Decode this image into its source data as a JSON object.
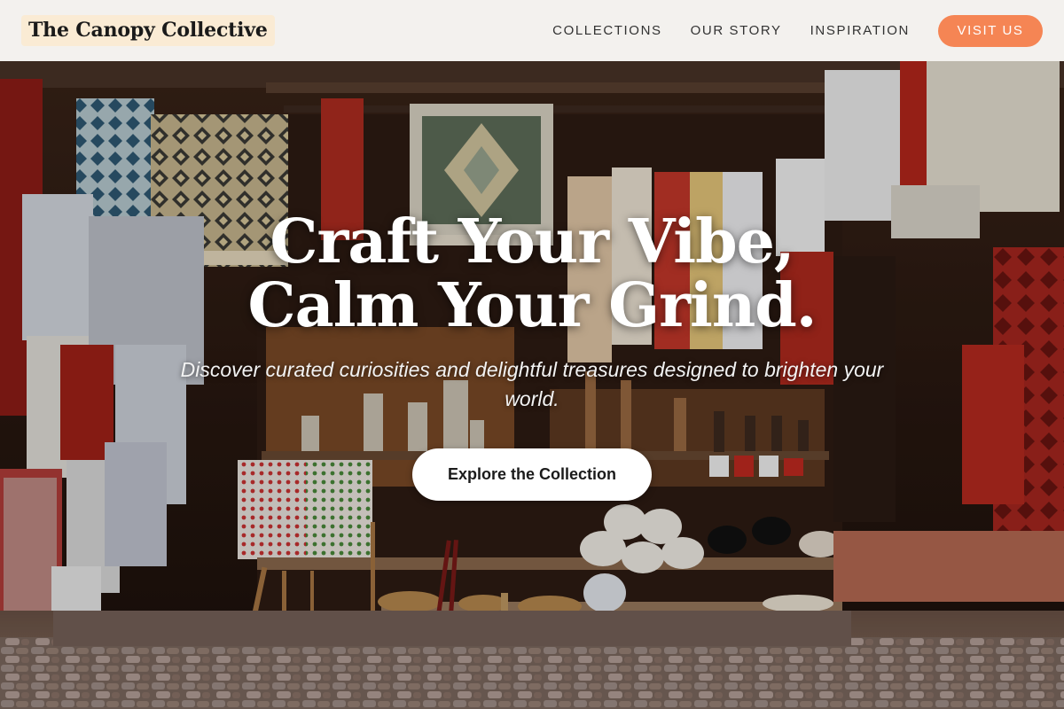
{
  "brand": {
    "name": "The Canopy Collective"
  },
  "nav": {
    "links": [
      "COLLECTIONS",
      "OUR STORY",
      "INSPIRATION"
    ],
    "cta": "VISIT US"
  },
  "hero": {
    "title_line1": "Craft Your Vibe,",
    "title_line2": "Calm Your Grind.",
    "subtitle": "Discover curated curiosities and delightful treasures designed to brighten your world.",
    "cta": "Explore the Collection"
  },
  "colors": {
    "header_bg": "#f3f1ee",
    "logo_bg": "#faebd4",
    "accent": "#f58554",
    "cta_bg": "#ffffff"
  }
}
